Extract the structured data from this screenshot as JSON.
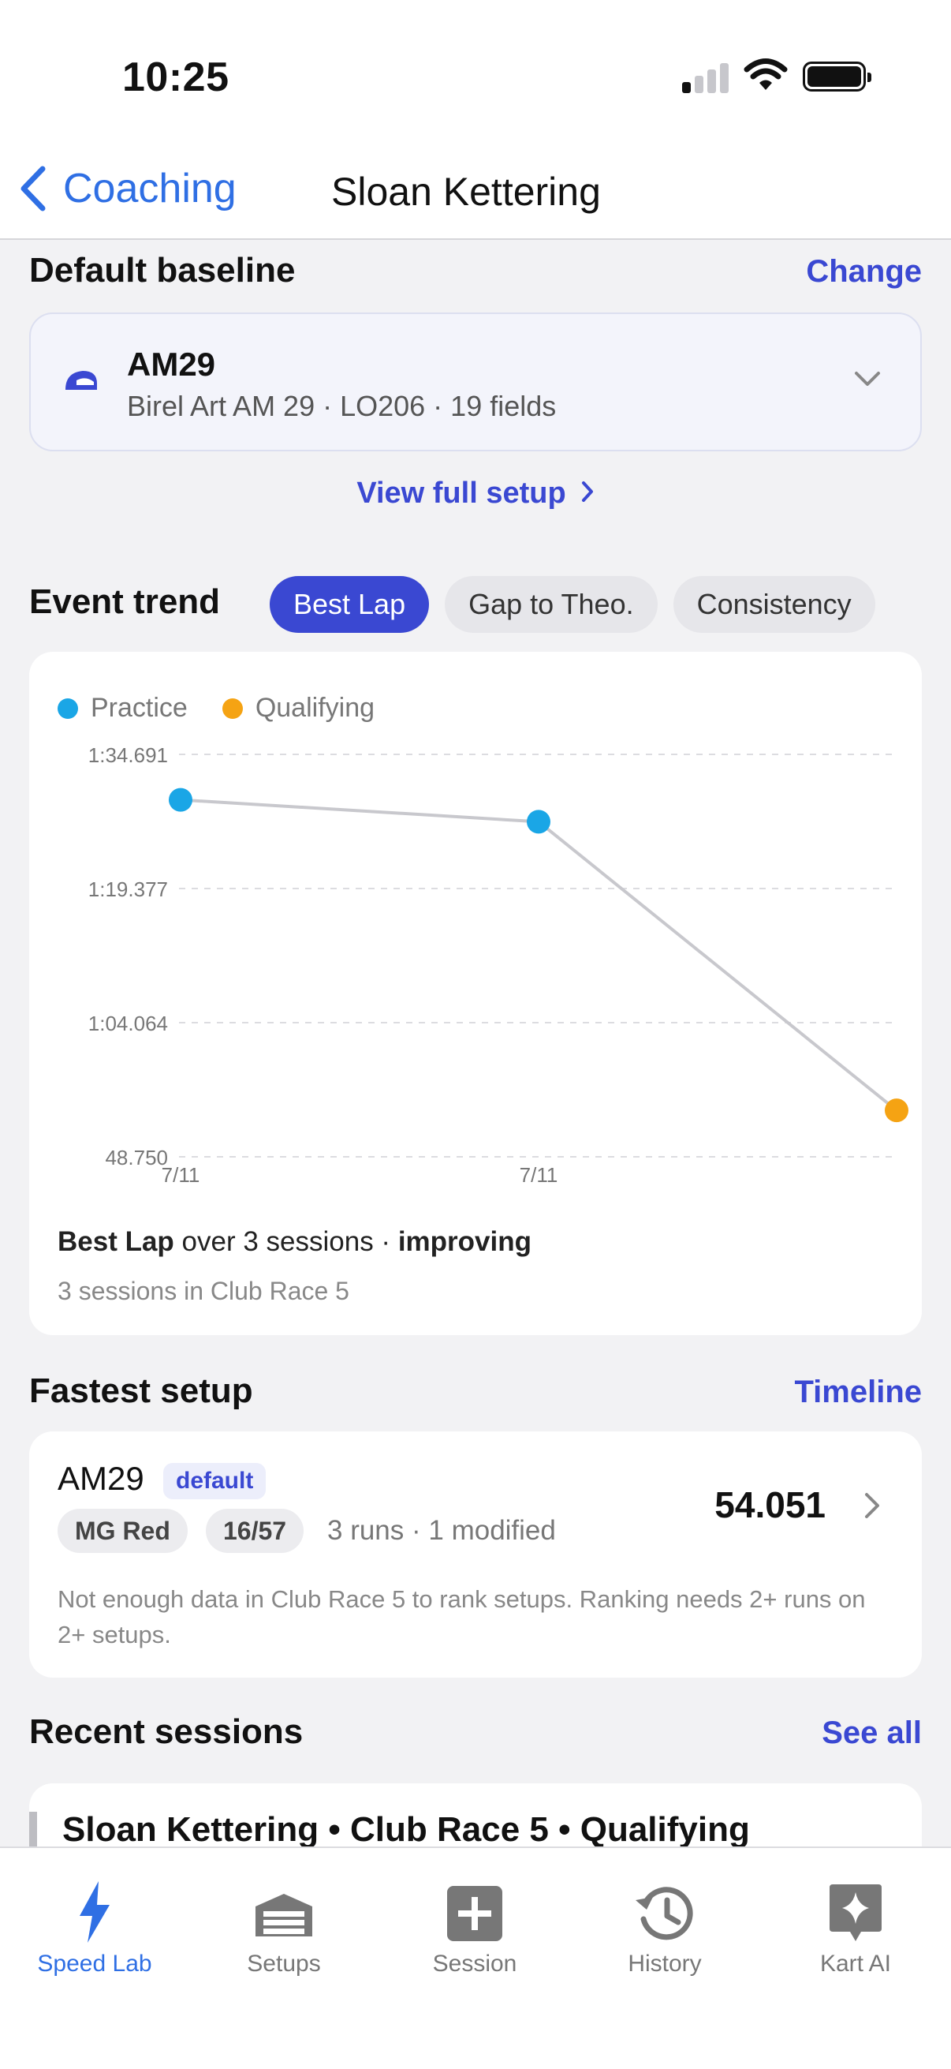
{
  "status_bar": {
    "time": "10:25"
  },
  "nav": {
    "back_label": "Coaching",
    "title": "Sloan Kettering"
  },
  "baseline": {
    "section_title": "Default baseline",
    "change_label": "Change",
    "name": "AM29",
    "subtitle": "Birel Art AM 29 · LO206 · 19 fields",
    "view_setup_label": "View full setup"
  },
  "event_trend": {
    "section_title": "Event trend",
    "tabs": [
      "Best Lap",
      "Gap to Theo.",
      "Consistency"
    ],
    "active_tab": "Best Lap",
    "summary_metric": "Best Lap",
    "summary_mid": " over 3 sessions · ",
    "summary_trend": "improving",
    "summary_sub": "3 sessions in Club Race 5"
  },
  "chart_data": {
    "type": "scatter",
    "legend": [
      {
        "name": "Practice",
        "color": "#1aa6e6"
      },
      {
        "name": "Qualifying",
        "color": "#f5a313"
      }
    ],
    "y_tick_labels": [
      "1:34.691",
      "1:19.377",
      "1:04.064",
      "48.750"
    ],
    "ylim_seconds": [
      48.75,
      94.691
    ],
    "x_tick_labels": [
      "7/11",
      "7/11"
    ],
    "points": [
      {
        "series": "Practice",
        "y_seconds": 89.5
      },
      {
        "series": "Practice",
        "y_seconds": 87.0
      },
      {
        "series": "Qualifying",
        "y_seconds": 54.05
      }
    ],
    "grid": true,
    "legend_position": "top-left"
  },
  "fastest_setup": {
    "section_title": "Fastest setup",
    "timeline_label": "Timeline",
    "name": "AM29",
    "badge": "default",
    "chips": [
      "MG Red",
      "16/57"
    ],
    "meta": "3 runs · 1 modified",
    "best_time": "54.051",
    "note": "Not enough data in Club Race 5 to rank setups. Ranking needs 2+ runs on 2+ setups."
  },
  "recent_sessions": {
    "section_title": "Recent sessions",
    "see_all_label": "See all",
    "items": [
      {
        "title": "Sloan Kettering • Club Race 5 • Qualifying"
      }
    ]
  },
  "tab_bar": {
    "items": [
      {
        "label": "Speed Lab",
        "icon": "bolt-icon",
        "active": true
      },
      {
        "label": "Setups",
        "icon": "garage-icon",
        "active": false
      },
      {
        "label": "Session",
        "icon": "plus-square-icon",
        "active": false
      },
      {
        "label": "History",
        "icon": "history-icon",
        "active": false
      },
      {
        "label": "Kart AI",
        "icon": "sparkle-icon",
        "active": false
      }
    ]
  },
  "colors": {
    "accent": "#3a48d2",
    "ios_blue": "#2f6fe4",
    "practice": "#1aa6e6",
    "qualifying": "#f5a313"
  }
}
